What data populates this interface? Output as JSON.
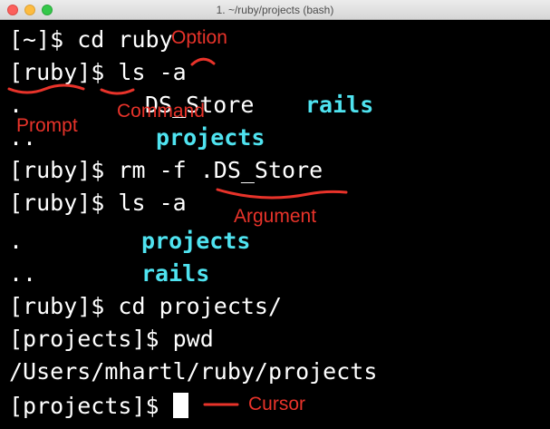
{
  "window": {
    "title": "1. ~/ruby/projects (bash)"
  },
  "terminal": {
    "lines": [
      {
        "a": "[~]$ cd ruby"
      },
      {
        "a": "[ruby]$ ls -a"
      },
      {
        "a": ".",
        "b": "DS_Store",
        "c": "rails"
      },
      {
        "a": "..",
        "b": "projects"
      },
      {
        "a": "[ruby]$ rm -f .DS_Store"
      },
      {
        "a": "[ruby]$ ls -a"
      },
      {
        "a": ".",
        "b": "projects"
      },
      {
        "a": "..",
        "b": "rails"
      },
      {
        "a": "[ruby]$ cd projects/"
      },
      {
        "a": "[projects]$ pwd"
      },
      {
        "a": "/Users/mhartl/ruby/projects"
      },
      {
        "a": "[projects]$ "
      }
    ]
  },
  "annotations": {
    "option": "Option",
    "prompt": "Prompt",
    "command": "Command",
    "argument": "Argument",
    "cursor": "Cursor",
    "color": "#e8332a"
  },
  "colors": {
    "background": "#000000",
    "text": "#ffffff",
    "directory": "#4fe3f0"
  }
}
